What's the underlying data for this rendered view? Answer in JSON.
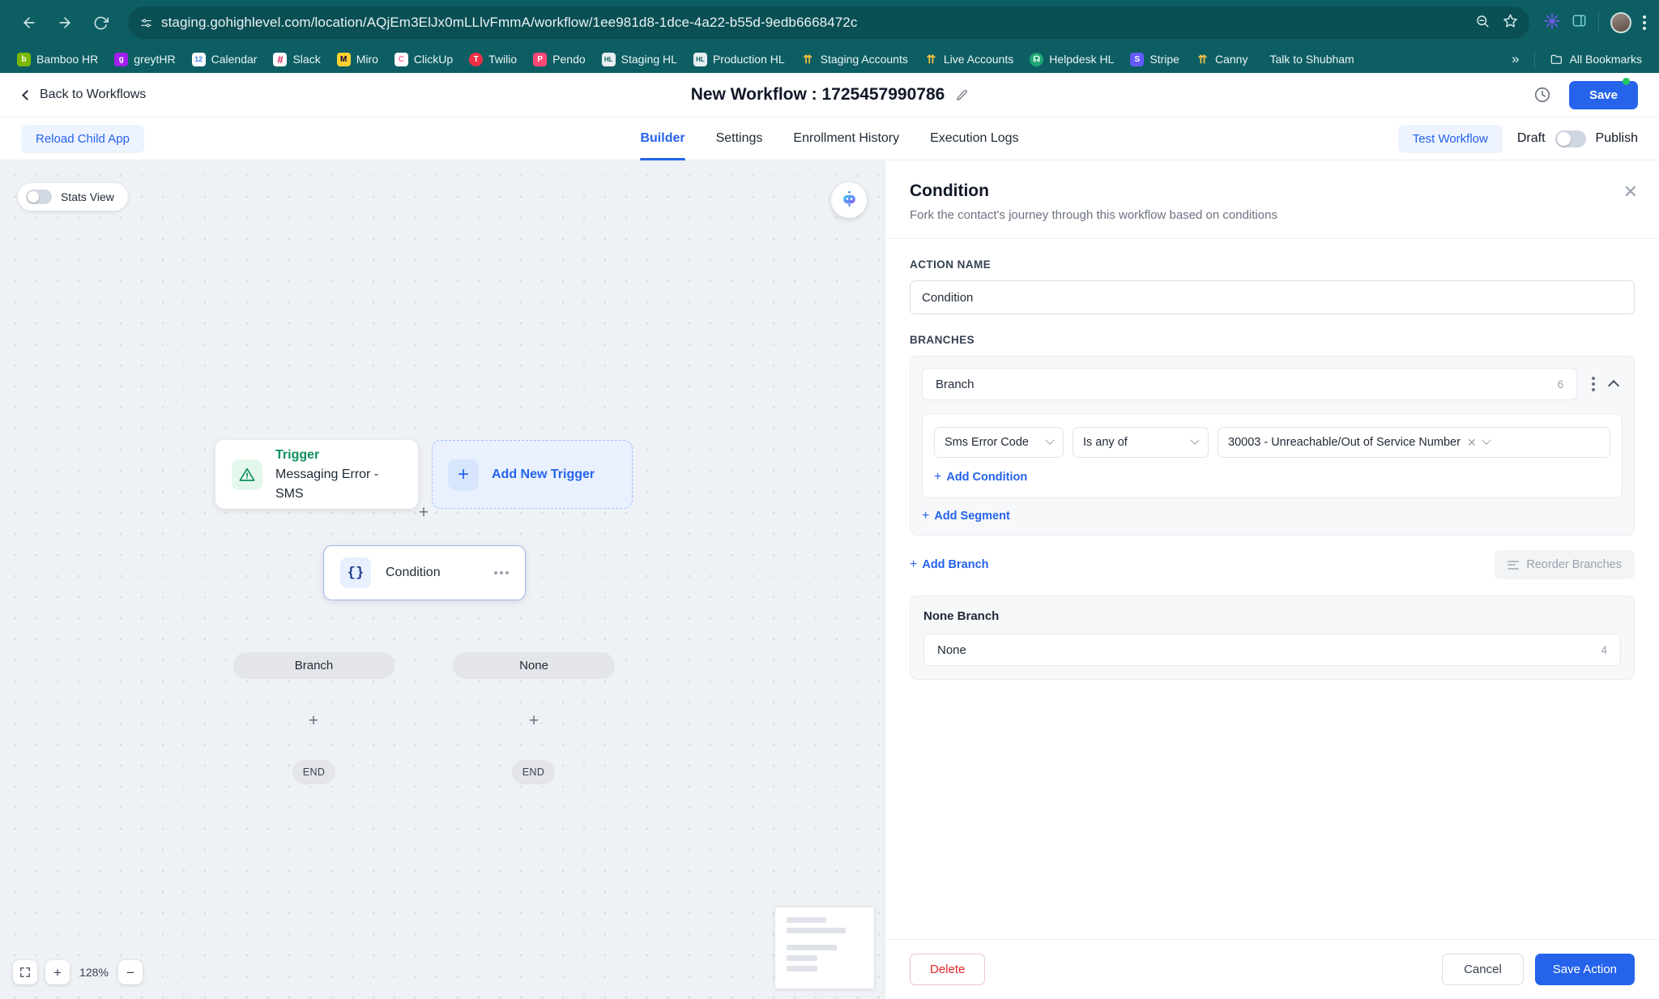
{
  "browser": {
    "url": "staging.gohighlevel.com/location/AQjEm3ElJx0mLLlvFmmA/workflow/1ee981d8-1dce-4a22-b55d-9edb6668472c",
    "back_icon": "back-arrow-icon",
    "forward_icon": "forward-arrow-icon",
    "reload_icon": "reload-icon",
    "bookmarks": [
      {
        "label": "Bamboo HR",
        "initial": "b",
        "color": "#7ab800"
      },
      {
        "label": "greytHR",
        "initial": "g",
        "color": "#a020f0"
      },
      {
        "label": "Calendar",
        "initial": "12",
        "color": "#ffffff"
      },
      {
        "label": "Slack",
        "initial": "#",
        "color": "#4a154b"
      },
      {
        "label": "Miro",
        "initial": "M",
        "color": "#ffd02f"
      },
      {
        "label": "ClickUp",
        "initial": "C",
        "color": "#ffffff"
      },
      {
        "label": "Twilio",
        "initial": "T",
        "color": "#f22f46"
      },
      {
        "label": "Pendo",
        "initial": "P",
        "color": "#ff4876"
      },
      {
        "label": "Staging HL",
        "initial": "S",
        "color": "#dfe8ec"
      },
      {
        "label": "Production HL",
        "initial": "P",
        "color": "#dfe8ec"
      },
      {
        "label": "Staging Accounts",
        "initial": "A",
        "color": "#f5c042"
      },
      {
        "label": "Live Accounts",
        "initial": "A",
        "color": "#f5c042"
      },
      {
        "label": "Helpdesk HL",
        "initial": "H",
        "color": "#1ea672"
      },
      {
        "label": "Stripe",
        "initial": "S",
        "color": "#635bff"
      },
      {
        "label": "Canny",
        "initial": "C",
        "color": "#f5c042"
      },
      {
        "label": "Talk to Shubham",
        "initial": "",
        "color": "transparent"
      }
    ],
    "overflow_label": "»",
    "all_bookmarks_label": "All Bookmarks"
  },
  "header": {
    "back_label": "Back to Workflows",
    "title": "New Workflow : 1725457990786",
    "save_label": "Save"
  },
  "toolbar": {
    "reload_child_app_label": "Reload Child App",
    "tabs": [
      {
        "label": "Builder",
        "active": true
      },
      {
        "label": "Settings",
        "active": false
      },
      {
        "label": "Enrollment History",
        "active": false
      },
      {
        "label": "Execution Logs",
        "active": false
      }
    ],
    "test_workflow_label": "Test Workflow",
    "draft_label": "Draft",
    "publish_label": "Publish"
  },
  "canvas": {
    "stats_view_label": "Stats View",
    "trigger_node": {
      "title": "Trigger",
      "subtitle": "Messaging Error - SMS"
    },
    "add_new_trigger_label": "Add New Trigger",
    "condition_node_label": "Condition",
    "branch_pill_1": "Branch",
    "branch_pill_2": "None",
    "end_pill_1": "END",
    "end_pill_2": "END",
    "plus_marker": "+",
    "zoom_level": "128%",
    "zoom_in_label": "+",
    "zoom_out_label": "−"
  },
  "panel": {
    "title": "Condition",
    "subtitle": "Fork the contact's journey through this workflow based on conditions",
    "close_label": "✕",
    "action_name_label": "ACTION NAME",
    "action_name_value": "Condition",
    "branches_label": "BRANCHES",
    "branch": {
      "name": "Branch",
      "count": "6",
      "condition": {
        "field": "Sms Error Code",
        "operator": "Is any of",
        "value": "30003 - Unreachable/Out of Service Number",
        "remove_label": "✕"
      },
      "add_condition_label": "Add Condition",
      "add_segment_label": "Add Segment"
    },
    "add_branch_label": "Add Branch",
    "reorder_branches_label": "Reorder Branches",
    "none_branch_title": "None Branch",
    "none_branch_name": "None",
    "none_branch_count": "4",
    "delete_label": "Delete",
    "cancel_label": "Cancel",
    "save_action_label": "Save Action"
  },
  "colors": {
    "chrome": "#0d5e63",
    "accent": "#2563eb",
    "trigger_green": "#0d8f5b",
    "danger": "#e02424"
  }
}
